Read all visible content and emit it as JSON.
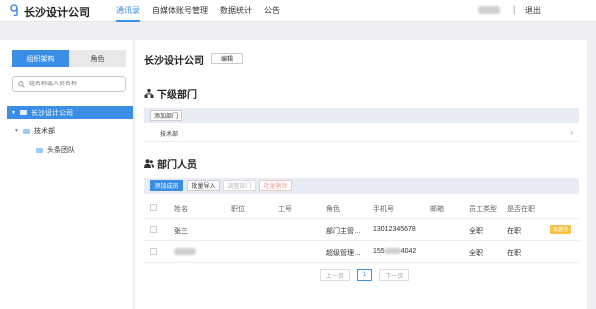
{
  "header": {
    "brand": "长沙设计公司",
    "nav": [
      "通讯录",
      "自媒体账号管理",
      "数据统计",
      "公告"
    ],
    "active_nav_index": 0,
    "separator": "|",
    "logout": "退出"
  },
  "sidebar": {
    "tabs": [
      "组织架构",
      "角色"
    ],
    "active_tab_index": 0,
    "search_placeholder": "组名称或人员名称",
    "tree": {
      "root": "长沙设计公司",
      "child": "技术部",
      "grandchild": "头条团队"
    }
  },
  "main": {
    "title": "长沙设计公司",
    "edit_label": "编辑",
    "sub_departments": {
      "title": "下级部门",
      "add_label": "添加部门",
      "items": [
        "技术部"
      ]
    },
    "members": {
      "title": "部门人员",
      "buttons": {
        "add": "添加成员",
        "import": "批量导入",
        "adjust": "调整部门",
        "delete": "批量删除"
      },
      "columns": [
        "姓名",
        "职位",
        "工号",
        "角色",
        "手机号",
        "邮箱",
        "员工类型",
        "是否在职"
      ],
      "rows": [
        {
          "name": "张三",
          "position": "",
          "id": "",
          "role": "部门主管…",
          "phone": "13012345678",
          "email": "",
          "type": "全职",
          "status": "在职",
          "badge": "未激活"
        },
        {
          "name": "",
          "position": "",
          "id": "",
          "role": "超级管理…",
          "phone_prefix": "155",
          "phone_suffix": "4042",
          "email": "",
          "type": "全职",
          "status": "在职",
          "badge": ""
        }
      ]
    },
    "pagination": {
      "prev": "上一页",
      "current": "1",
      "next": "下一页"
    }
  },
  "colors": {
    "accent": "#3a8ee6",
    "badge": "#f6c343",
    "background": "#eef0f3"
  }
}
